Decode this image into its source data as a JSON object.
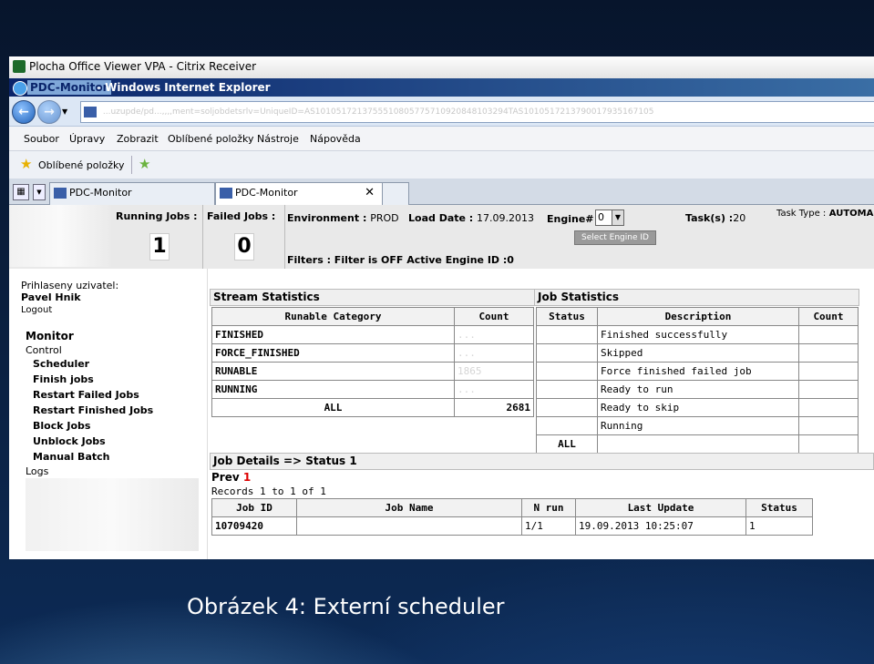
{
  "citrix_title": "Plocha Office Viewer VPA - Citrix Receiver",
  "ie_title_highlight": "PDC-Monitor",
  "ie_title_rest": "- Windows Internet Explorer",
  "url": "...uzupde/pd...,,,,ment=soljobdetsrlv=UniqueID=AS1010517213755510805775710920848103294TAS1010517213790017935167105",
  "menu": [
    "Soubor",
    "Úpravy",
    "Zobrazit",
    "Oblíbené položky",
    "Nástroje",
    "Nápověda"
  ],
  "favorites_label": "Oblíbené položky",
  "tabs": [
    {
      "label": "PDC-Monitor"
    },
    {
      "label": "PDC-Monitor"
    }
  ],
  "header": {
    "running_jobs_label": "Running Jobs :",
    "failed_jobs_label": "Failed Jobs :",
    "running_jobs": "1",
    "failed_jobs": "0",
    "environment_label": "Environment :",
    "environment": "PROD",
    "load_date_label": "Load Date :",
    "load_date": "17.09.2013",
    "engine_label": "Engine#",
    "engine_value": "0",
    "select_engine": "Select Engine ID",
    "tasks_label": "Task(s) :",
    "tasks": "20",
    "task_type_label": "Task Type :",
    "task_type": "AUTOMA",
    "filters_line": "Filters :   Filter is OFF   Active Engine ID :0"
  },
  "sidebar": {
    "user_label": "Prihlaseny uzivatel:",
    "user_name": "Pavel Hnik",
    "logout": "Logout",
    "monitor": "Monitor",
    "control": "Control",
    "items": [
      "Scheduler",
      "Finish jobs",
      "Restart Failed Jobs",
      "Restart Finished Jobs",
      "Block Jobs",
      "Unblock Jobs",
      "Manual Batch"
    ],
    "logs": "Logs"
  },
  "stream_stats": {
    "title": "Stream Statistics",
    "headers": [
      "Runable Category",
      "Count"
    ],
    "rows": [
      [
        "FINISHED",
        "..."
      ],
      [
        "FORCE_FINISHED",
        "..."
      ],
      [
        "RUNABLE",
        "1865"
      ],
      [
        "RUNNING",
        "..."
      ]
    ],
    "total": [
      "ALL",
      "2681"
    ]
  },
  "job_stats": {
    "title": "Job Statistics",
    "headers": [
      "Status",
      "Description",
      "Count"
    ],
    "rows": [
      [
        "",
        "Finished successfully",
        ""
      ],
      [
        "",
        "Skipped",
        ""
      ],
      [
        "",
        "Force finished failed job",
        ""
      ],
      [
        "",
        "Ready to run",
        ""
      ],
      [
        "",
        "Ready to skip",
        ""
      ],
      [
        "",
        "Running",
        ""
      ]
    ],
    "total": [
      "ALL",
      "",
      ""
    ]
  },
  "job_details": {
    "title": "Job Details => Status 1",
    "prev": "Prev",
    "page": "1",
    "records": "Records 1 to 1 of 1",
    "headers": [
      "Job ID",
      "Job Name",
      "N run",
      "Last Update",
      "Status"
    ],
    "row": [
      "10709420",
      "",
      "1/1",
      "19.09.2013 10:25:07",
      "1"
    ]
  },
  "caption": "Obrázek 4: Externí scheduler"
}
